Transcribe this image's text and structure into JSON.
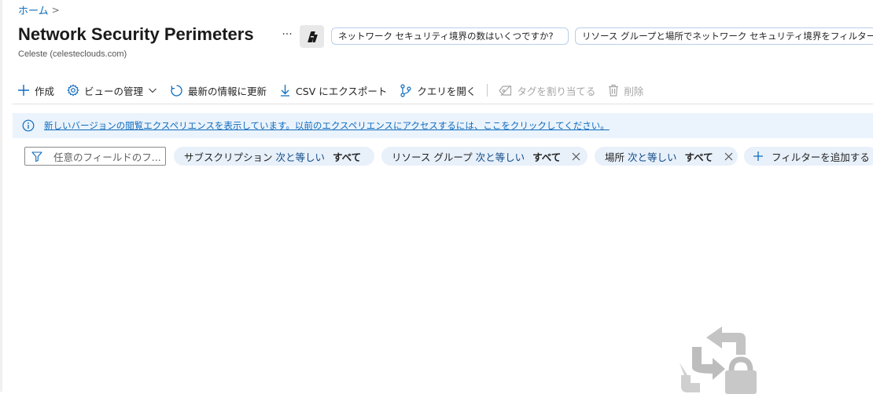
{
  "breadcrumb": {
    "home": "ホーム",
    "separator": ">"
  },
  "header": {
    "title": "Network Security Perimeters",
    "subtitle": "Celeste (celesteclouds.com)",
    "more": "···"
  },
  "prompts": [
    "ネットワーク セキュリティ境界の数はいくつですか?",
    "リソース グループと場所でネットワーク セキュリティ境界をフィルター"
  ],
  "toolbar": {
    "create": "作成",
    "manage_view": "ビューの管理",
    "refresh": "最新の情報に更新",
    "export_csv": "CSV にエクスポート",
    "open_query": "クエリを開く",
    "assign_tags": "タグを割り当てる",
    "delete": "削除"
  },
  "banner": {
    "text": "新しいバージョンの閲覧エクスペリエンスを表示しています。以前のエクスペリエンスにアクセスするには、ここをクリックしてください。"
  },
  "filter": {
    "placeholder": "任意のフィールドのフ...",
    "pills": [
      {
        "field": "サブスクリプション",
        "op": "次と等しい",
        "value": "すべて"
      },
      {
        "field": "リソース グループ",
        "op": "次と等しい",
        "value": "すべて"
      },
      {
        "field": "場所",
        "op": "次と等しい",
        "value": "すべて"
      }
    ],
    "add_filter": "フィルターを追加する"
  },
  "colors": {
    "accent": "#0f6cbd",
    "banner_bg": "#ebf3fc",
    "pill_bg": "#e8f0fa"
  }
}
